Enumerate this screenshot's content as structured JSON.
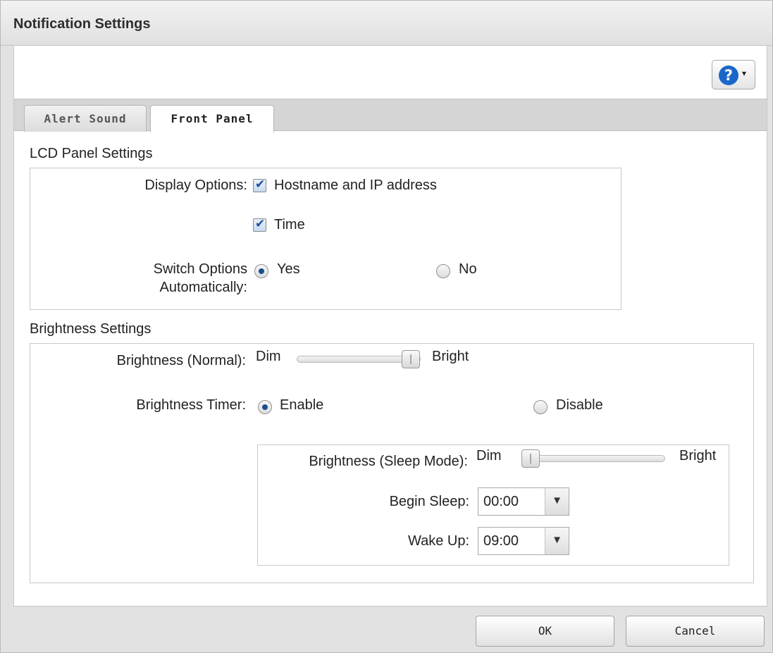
{
  "window": {
    "title": "Notification Settings"
  },
  "help": {
    "icon": "help-icon",
    "glyph": "?",
    "caret": "▾"
  },
  "tabs": [
    {
      "label": "Alert Sound",
      "active": false
    },
    {
      "label": "Front Panel",
      "active": true
    }
  ],
  "lcd": {
    "section_title": "LCD Panel Settings",
    "display_label": "Display Options:",
    "hostname_label": "Hostname and IP address",
    "hostname_checked": true,
    "time_label": "Time",
    "time_checked": true,
    "switch_label_line1": "Switch Options",
    "switch_label_line2": "Automatically:",
    "yes_label": "Yes",
    "no_label": "No",
    "switch_selected": "Yes"
  },
  "brightness": {
    "section_title": "Brightness Settings",
    "normal_label": "Brightness (Normal):",
    "dim_label": "Dim",
    "bright_label": "Bright",
    "normal_level": 1.0,
    "timer_label": "Brightness Timer:",
    "enable_label": "Enable",
    "disable_label": "Disable",
    "timer_selected": "Enable",
    "sleep_label": "Brightness (Sleep Mode):",
    "sleep_dim_label": "Dim",
    "sleep_bright_label": "Bright",
    "sleep_level": 0.0,
    "begin_label": "Begin Sleep:",
    "begin_value": "00:00",
    "wake_label": "Wake Up:",
    "wake_value": "09:00"
  },
  "footer": {
    "ok_label": "OK",
    "cancel_label": "Cancel"
  }
}
